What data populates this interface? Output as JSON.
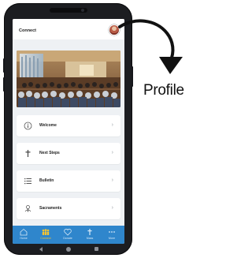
{
  "app": {
    "title": "Connect"
  },
  "hero": {
    "image": "church-congregation-photo"
  },
  "menu": [
    {
      "label": "Welcome",
      "icon": "info-circle-icon"
    },
    {
      "label": "Next Steps",
      "icon": "cross-icon"
    },
    {
      "label": "Bulletin",
      "icon": "list-icon"
    },
    {
      "label": "Sacraments",
      "icon": "holy-spirit-icon"
    }
  ],
  "chevron": "›",
  "tabs": [
    {
      "label": "Home",
      "icon": "home-icon"
    },
    {
      "label": "Connect",
      "icon": "people-icon",
      "active": true
    },
    {
      "label": "Donate",
      "icon": "heart-icon"
    },
    {
      "label": "Mass",
      "icon": "cross-icon"
    },
    {
      "label": "More",
      "icon": "more-dots-icon"
    }
  ],
  "callout": {
    "label": "Profile"
  },
  "colors": {
    "tabbar": "#2f86cc",
    "active_tab": "#f4c430",
    "frame": "#1c1d21"
  }
}
